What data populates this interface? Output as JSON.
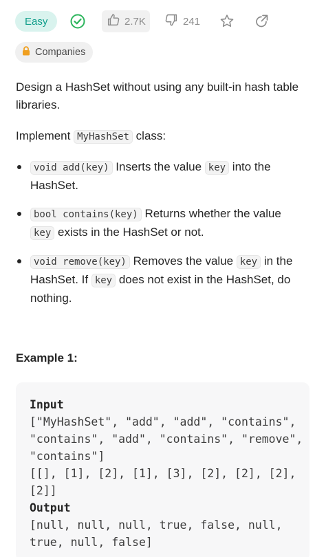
{
  "toolbar": {
    "difficulty": "Easy",
    "likes": "2.7K",
    "dislikes": "241"
  },
  "companies_label": "Companies",
  "description": {
    "p1": "Design a HashSet without using any built-in hash table libraries.",
    "p2_before": "Implement ",
    "p2_code": "MyHashSet",
    "p2_after": " class:",
    "bullets": [
      {
        "code1": "void add(key)",
        "text1": " Inserts the value ",
        "code2": "key",
        "text2": " into the HashSet."
      },
      {
        "code1": "bool contains(key)",
        "text1": " Returns whether the value ",
        "code2": "key",
        "text2": " exists in the HashSet or not."
      },
      {
        "code1": "void remove(key)",
        "text1": " Removes the value ",
        "code2": "key",
        "text2": " in the HashSet. If ",
        "code3": "key",
        "text3": " does not exist in the HashSet, do nothing."
      }
    ]
  },
  "example": {
    "title": "Example 1:",
    "input_label": "Input",
    "input_line1": "[\"MyHashSet\", \"add\", \"add\", \"contains\", \"contains\", \"add\", \"contains\", \"remove\", \"contains\"]",
    "input_line2": "[[], [1], [2], [1], [3], [2], [2], [2], [2]]",
    "output_label": "Output",
    "output_line": "[null, null, null, true, false, null, true, null, false]"
  }
}
